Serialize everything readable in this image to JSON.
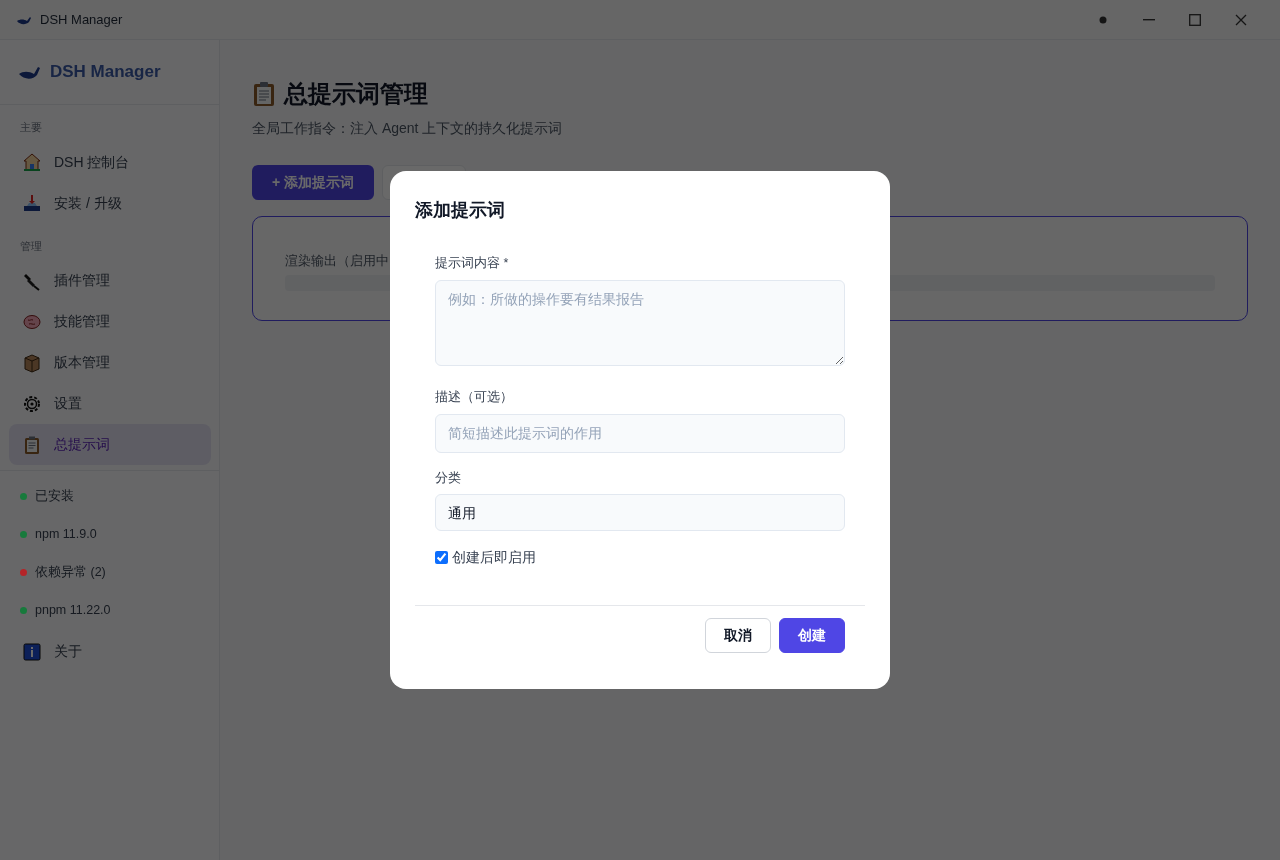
{
  "window": {
    "title": "DSH Manager"
  },
  "sidebar": {
    "brand": "DSH Manager",
    "sections": [
      {
        "title": "主要",
        "items": [
          {
            "label": "DSH 控制台",
            "kind": "home",
            "selected": false
          },
          {
            "label": "安装 / 升级",
            "kind": "install",
            "selected": false
          }
        ]
      },
      {
        "title": "管理",
        "items": [
          {
            "label": "插件管理",
            "kind": "plug",
            "selected": false
          },
          {
            "label": "技能管理",
            "kind": "brain",
            "selected": false
          },
          {
            "label": "版本管理",
            "kind": "box",
            "selected": false
          },
          {
            "label": "设置",
            "kind": "gear",
            "selected": false
          },
          {
            "label": "总提示词",
            "kind": "clipboard",
            "selected": true
          }
        ]
      }
    ],
    "status": [
      {
        "label": "已安装",
        "color": "#177a3c"
      },
      {
        "label": "npm 11.9.0",
        "color": "#177a3c"
      },
      {
        "label": "依赖异常 (2)",
        "color": "#b52428"
      },
      {
        "label": "pnpm 11.22.0",
        "color": "#177a3c"
      }
    ],
    "about": {
      "label": "关于",
      "kind": "info"
    }
  },
  "page": {
    "title": "总提示词管理",
    "subtitle": "全局工作指令：注入 Agent 上下文的持久化提示词",
    "add_button": "+ 添加提示词",
    "panel_label": "渲染输出（启用中"
  },
  "modal": {
    "title": "添加提示词",
    "fields": [
      {
        "kind": "textarea",
        "label": "提示词内容 *",
        "placeholder": "例如：所做的操作要有结果报告"
      },
      {
        "kind": "input",
        "label": "描述（可选）",
        "placeholder": "简短描述此提示词的作用"
      },
      {
        "kind": "select",
        "label": "分类",
        "value": "通用"
      },
      {
        "kind": "checkbox",
        "label": "创建后即启用",
        "checked": true
      }
    ],
    "buttons": [
      {
        "label": "取消",
        "kind": "secondary"
      },
      {
        "label": "创建",
        "kind": "primary"
      }
    ]
  }
}
